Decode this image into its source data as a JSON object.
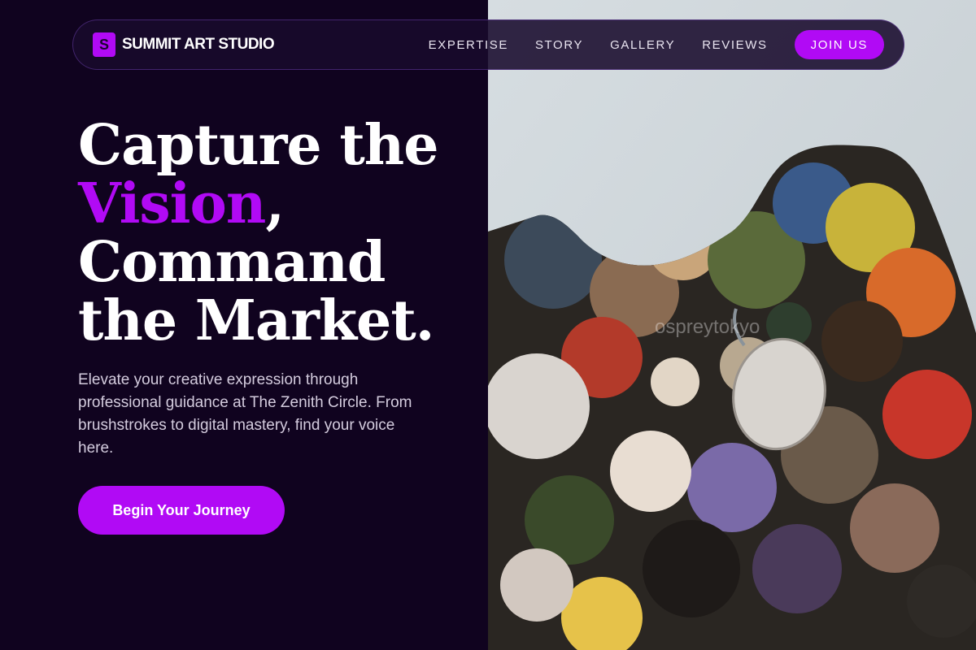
{
  "brand": {
    "mark": "S",
    "name": "SUMMIT ART STUDIO"
  },
  "nav": {
    "links": [
      "EXPERTISE",
      "STORY",
      "GALLERY",
      "REVIEWS"
    ],
    "cta": "JOIN US"
  },
  "hero": {
    "headline_line1": "Capture the",
    "headline_accent": "Vision",
    "headline_comma": ",",
    "headline_line3": "Command",
    "headline_line4": "the Market.",
    "subtitle": "Elevate your creative expression through professional guidance at The Zenith Circle. From brushstrokes to digital mastery, find your voice here.",
    "cta": "Begin Your Journey"
  },
  "image": {
    "watermark": "ospreytokyo"
  },
  "colors": {
    "accent": "#b10af5",
    "background": "#10031f"
  }
}
